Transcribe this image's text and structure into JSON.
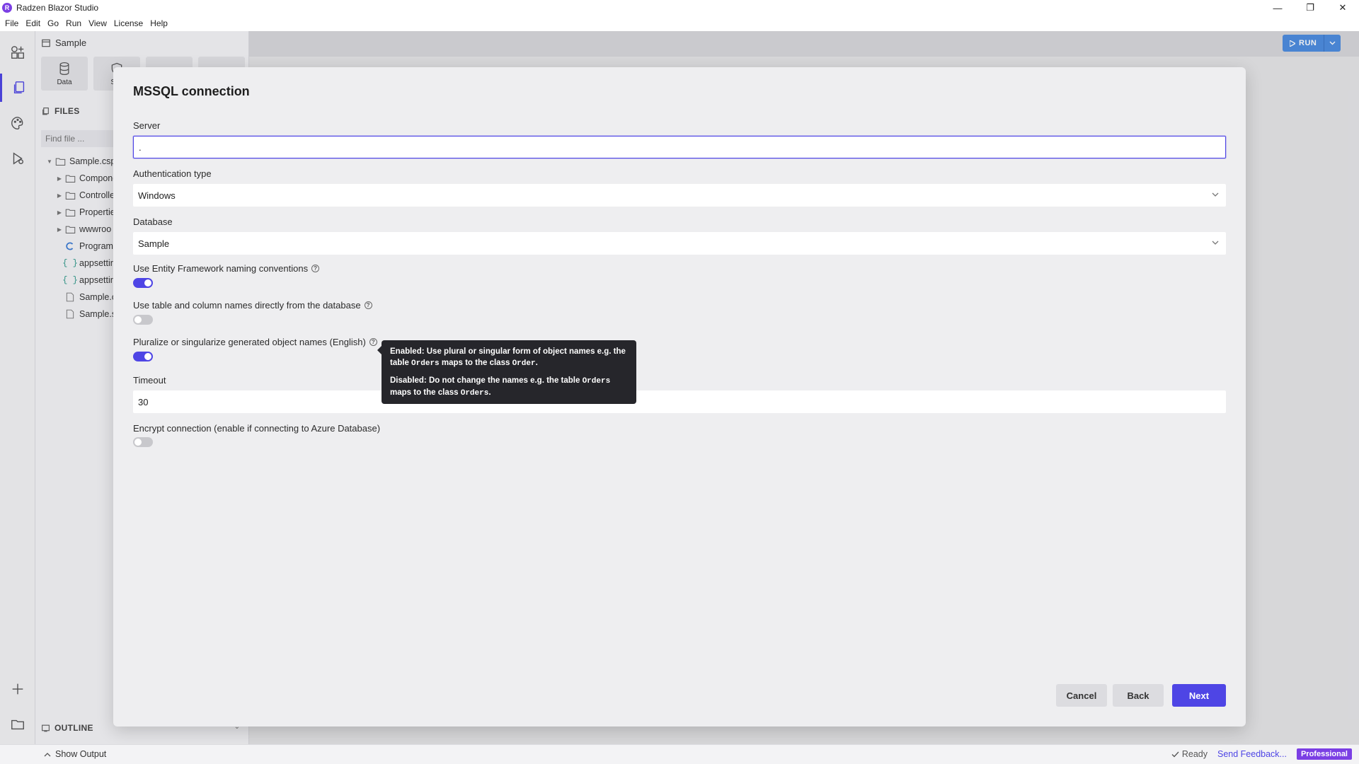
{
  "window": {
    "title": "Radzen Blazor Studio",
    "logo_letter": "R",
    "controls": {
      "minimize": "—",
      "restore": "❐",
      "close": "✕"
    }
  },
  "menu": [
    "File",
    "Edit",
    "Go",
    "Run",
    "View",
    "License",
    "Help"
  ],
  "activity_icons": [
    "add-components-icon",
    "files-icon",
    "palette-icon",
    "run-debug-icon",
    "plus-icon",
    "folder-icon",
    "settings-icon"
  ],
  "sidebar": {
    "project_name": "Sample",
    "tabs": [
      {
        "label": "Data",
        "icon": "database-icon"
      },
      {
        "label": "Sec",
        "icon": "shield-icon"
      },
      {
        "label": "",
        "icon": "git-icon"
      },
      {
        "label": "",
        "icon": "deploy-icon"
      }
    ],
    "files_title": "FILES",
    "find_placeholder": "Find file ...",
    "tree": [
      {
        "label": "Sample.csp",
        "type": "folder",
        "level": 0,
        "expanded": true
      },
      {
        "label": "Compone",
        "type": "folder",
        "level": 1
      },
      {
        "label": "Controlle",
        "type": "folder",
        "level": 1
      },
      {
        "label": "Propertie",
        "type": "folder",
        "level": 1
      },
      {
        "label": "wwwroo",
        "type": "folder",
        "level": 1
      },
      {
        "label": "Program",
        "type": "csharp",
        "level": 1
      },
      {
        "label": "appsettir",
        "type": "json",
        "level": 1
      },
      {
        "label": "appsettir",
        "type": "json",
        "level": 1
      },
      {
        "label": "Sample.c",
        "type": "file",
        "level": 1
      },
      {
        "label": "Sample.s",
        "type": "file",
        "level": 1
      }
    ],
    "outline_title": "OUTLINE"
  },
  "toolbar": {
    "run_label": "RUN"
  },
  "dialog": {
    "title": "MSSQL connection",
    "server": {
      "label": "Server",
      "value": "."
    },
    "auth": {
      "label": "Authentication type",
      "value": "Windows"
    },
    "database": {
      "label": "Database",
      "value": "Sample"
    },
    "ef_naming": {
      "label": "Use Entity Framework naming conventions",
      "on": true
    },
    "direct_names": {
      "label": "Use table and column names directly from the database",
      "on": false
    },
    "pluralize": {
      "label": "Pluralize or singularize generated object names (English)",
      "on": true
    },
    "timeout": {
      "label": "Timeout",
      "value": "30"
    },
    "encrypt": {
      "label": "Encrypt connection (enable if connecting to Azure Database)",
      "on": false
    },
    "help_glyph": "?",
    "tooltip": {
      "enabled_prefix": "Enabled: Use plural or singular form of object names e.g. the table ",
      "enabled_code1": "Orders",
      "enabled_mid": " maps to the class ",
      "enabled_code2": "Order",
      "enabled_suffix": ".",
      "disabled_prefix": "Disabled: Do not change the names e.g. the table ",
      "disabled_code1": "Orders",
      "disabled_mid": " maps to the class ",
      "disabled_code2": "Orders",
      "disabled_suffix": "."
    },
    "buttons": {
      "cancel": "Cancel",
      "back": "Back",
      "next": "Next"
    }
  },
  "statusbar": {
    "show_output": "Show Output",
    "ready": "Ready",
    "feedback": "Send Feedback...",
    "badge": "Professional"
  },
  "colors": {
    "accent": "#4e45e5",
    "brand": "#7b3fe4",
    "run": "#4d8de0"
  }
}
